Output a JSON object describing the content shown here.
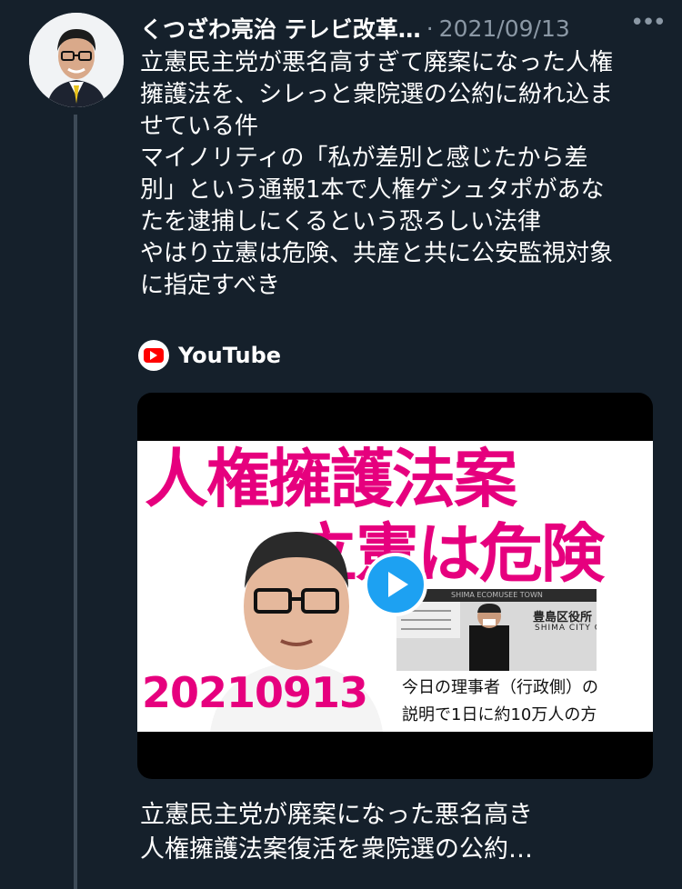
{
  "tweet": {
    "author_name": "くつざわ亮治 テレビ改革…",
    "separator": "·",
    "date": "2021/09/13",
    "more_icon": "more-dots-icon",
    "body_lines": [
      "立憲民主党が悪名高すぎて廃案になった人権",
      "擁護法を、シレっと衆院選の公約に紛れ込ま",
      "せている件",
      "マイノリティの「私が差別と感じたから差",
      "別」という通報1本で人権ゲシュタポがあな",
      "たを逮捕しにくるという恐ろしい法律",
      "やはり立憲は危険、共産と共に公安監視対象",
      "に指定すべき"
    ]
  },
  "card": {
    "source_icon": "youtube-icon",
    "source_name": "YouTube",
    "thumbnail": {
      "title_line1": "人権擁護法案",
      "title_line2": "立憲は危険",
      "date_text": "20210913",
      "inset_sign": "豊島区役所",
      "inset_sign_en": "SHIMA CITY OFFICE",
      "inset_top": "SHIMA ECOMUSEE TOWN",
      "caption_line1": "今日の理事者（行政側）の",
      "caption_line2": "説明で1日に約10万人の方"
    },
    "play_icon": "play-button-icon",
    "link_title_line1": "立憲民主党が廃案になった悪名高き",
    "link_title_line2": "人権擁護法案復活を衆院選の公約…"
  },
  "colors": {
    "background": "#15202b",
    "accent_pink": "#e6007e",
    "play_blue": "#1da1f2",
    "muted_text": "#8b98a5"
  }
}
